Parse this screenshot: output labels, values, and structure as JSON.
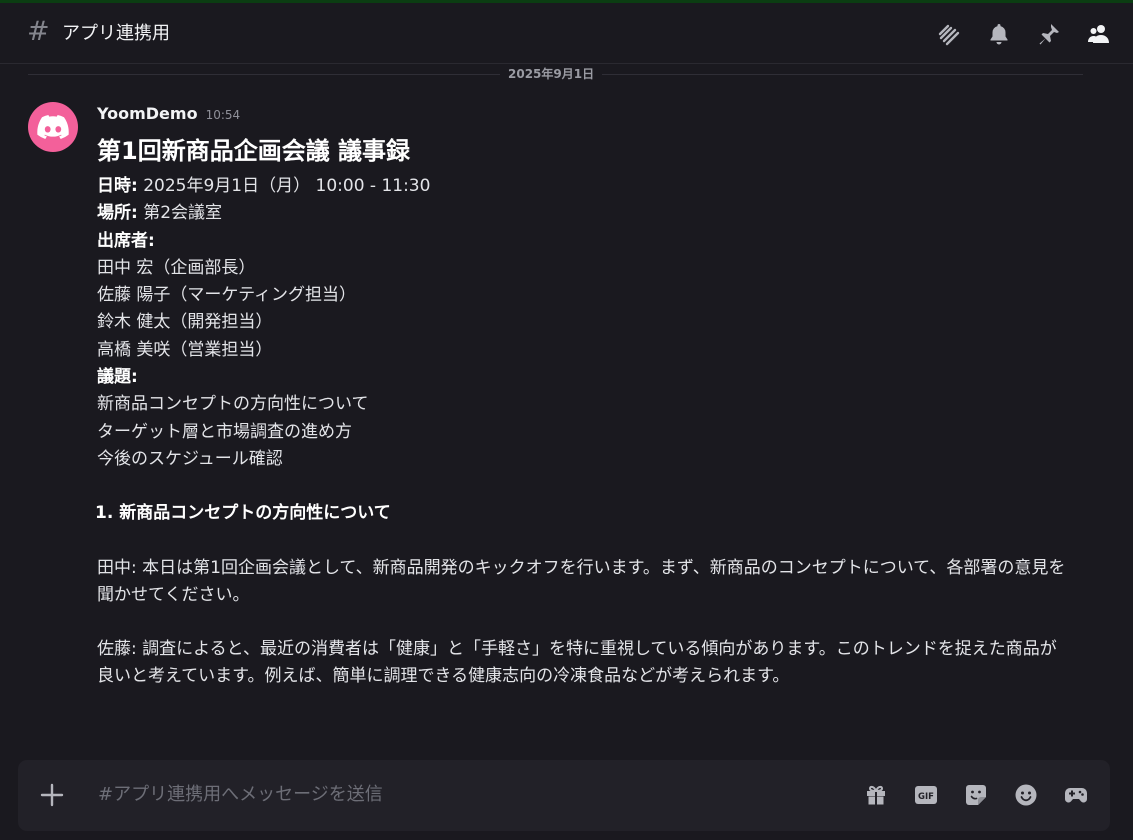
{
  "header": {
    "channel_prefix": "#",
    "channel_name": "アプリ連携用"
  },
  "header_icons": [
    "threads-icon",
    "bell-icon",
    "pin-icon",
    "members-icon"
  ],
  "date_divider": "2025年9月1日",
  "message": {
    "author": "YoomDemo",
    "time": "10:54",
    "title": "第1回新商品企画会議 議事録",
    "datetime_label": "日時:",
    "datetime_value": " 2025年9月1日（月） 10:00 - 11:30",
    "place_label": "場所:",
    "place_value": " 第2会議室",
    "attendees_label": "出席者:",
    "attendees": [
      "田中 宏（企画部長）",
      "佐藤 陽子（マーケティング担当）",
      "鈴木 健太（開発担当）",
      "高橋 美咲（営業担当）"
    ],
    "agenda_label": "議題:",
    "agenda": [
      "新商品コンセプトの方向性について",
      "ターゲット層と市場調査の進め方",
      "今後のスケジュール確認"
    ],
    "section1_heading": "1. 新商品コンセプトの方向性について",
    "para1": "田中: 本日は第1回企画会議として、新商品開発のキックオフを行います。まず、新商品のコンセプトについて、各部署の意見を聞かせてください。",
    "para2": "佐藤: 調査によると、最近の消費者は「健康」と「手軽さ」を特に重視している傾向があります。このトレンドを捉えた商品が良いと考えています。例えば、簡単に調理できる健康志向の冷凍食品などが考えられます。"
  },
  "composer": {
    "placeholder": "#アプリ連携用へメッセージを送信",
    "gif_label": "GIF"
  },
  "composer_icons": [
    "add-icon",
    "gift-icon",
    "gif-icon",
    "sticker-icon",
    "emoji-icon",
    "game-icon"
  ],
  "colors": {
    "background": "#1a191f",
    "composer": "#222128",
    "avatar": "#f3609a",
    "top_accent": "#0b3d12"
  }
}
